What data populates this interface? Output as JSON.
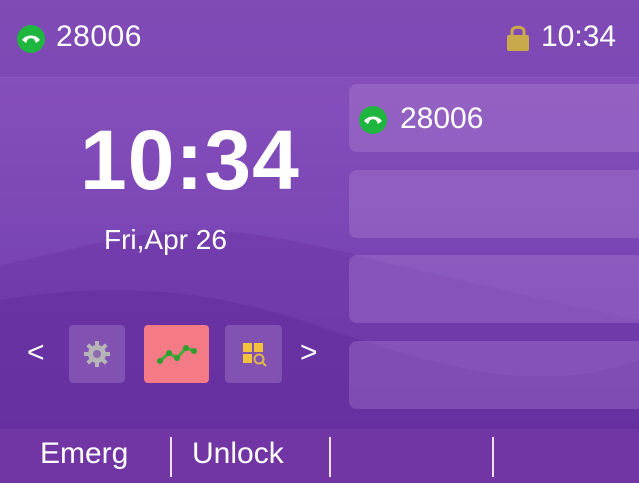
{
  "status": {
    "number": "28006",
    "time": "10:34"
  },
  "home": {
    "time": "10:34",
    "date": "Fri,Apr 26"
  },
  "switcher": {
    "left_arrow": "<",
    "right_arrow": ">",
    "apps": [
      "settings-icon",
      "status-icon",
      "directory-search-icon"
    ]
  },
  "linekeys": [
    {
      "label": "28006",
      "icon": "phone-handset-icon"
    },
    {
      "label": ""
    },
    {
      "label": ""
    },
    {
      "label": ""
    }
  ],
  "softkeys": [
    "Emerg",
    "Unlock",
    "",
    ""
  ],
  "colors": {
    "accent_green": "#1fb63f",
    "active_app": "#f47a86",
    "lock": "#c9a94a"
  }
}
